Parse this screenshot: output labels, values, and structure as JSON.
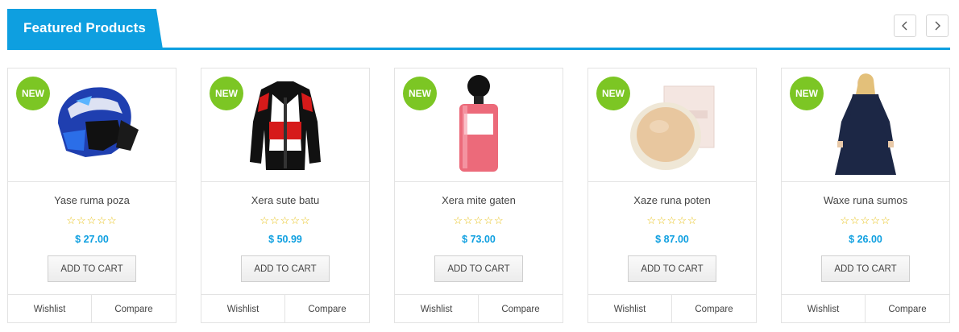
{
  "header": {
    "title": "Featured Products",
    "accent": "#0e9fe0"
  },
  "nav": {
    "prev_icon": "chevron-left-icon",
    "next_icon": "chevron-right-icon"
  },
  "badge_color": "#7cc624",
  "products": [
    {
      "badge": "NEW",
      "name": "Yase ruma poza",
      "stars": "☆☆☆☆☆",
      "rating": 0,
      "price": "$ 27.00",
      "add_to_cart": "ADD TO CART",
      "wishlist": "Wishlist",
      "compare": "Compare",
      "image": "motocross-helmet"
    },
    {
      "badge": "NEW",
      "name": "Xera sute batu",
      "stars": "☆☆☆☆☆",
      "rating": 0,
      "price": "$ 50.99",
      "add_to_cart": "ADD TO CART",
      "wishlist": "Wishlist",
      "compare": "Compare",
      "image": "racing-jacket"
    },
    {
      "badge": "NEW",
      "name": "Xera mite gaten",
      "stars": "☆☆☆☆☆",
      "rating": 0,
      "price": "$ 73.00",
      "add_to_cart": "ADD TO CART",
      "wishlist": "Wishlist",
      "compare": "Compare",
      "image": "nail-polish"
    },
    {
      "badge": "NEW",
      "name": "Xaze runa poten",
      "stars": "☆☆☆☆☆",
      "rating": 0,
      "price": "$ 87.00",
      "add_to_cart": "ADD TO CART",
      "wishlist": "Wishlist",
      "compare": "Compare",
      "image": "powder-compact"
    },
    {
      "badge": "NEW",
      "name": "Waxe runa sumos",
      "stars": "☆☆☆☆☆",
      "rating": 0,
      "price": "$ 26.00",
      "add_to_cart": "ADD TO CART",
      "wishlist": "Wishlist",
      "compare": "Compare",
      "image": "navy-dress"
    }
  ]
}
